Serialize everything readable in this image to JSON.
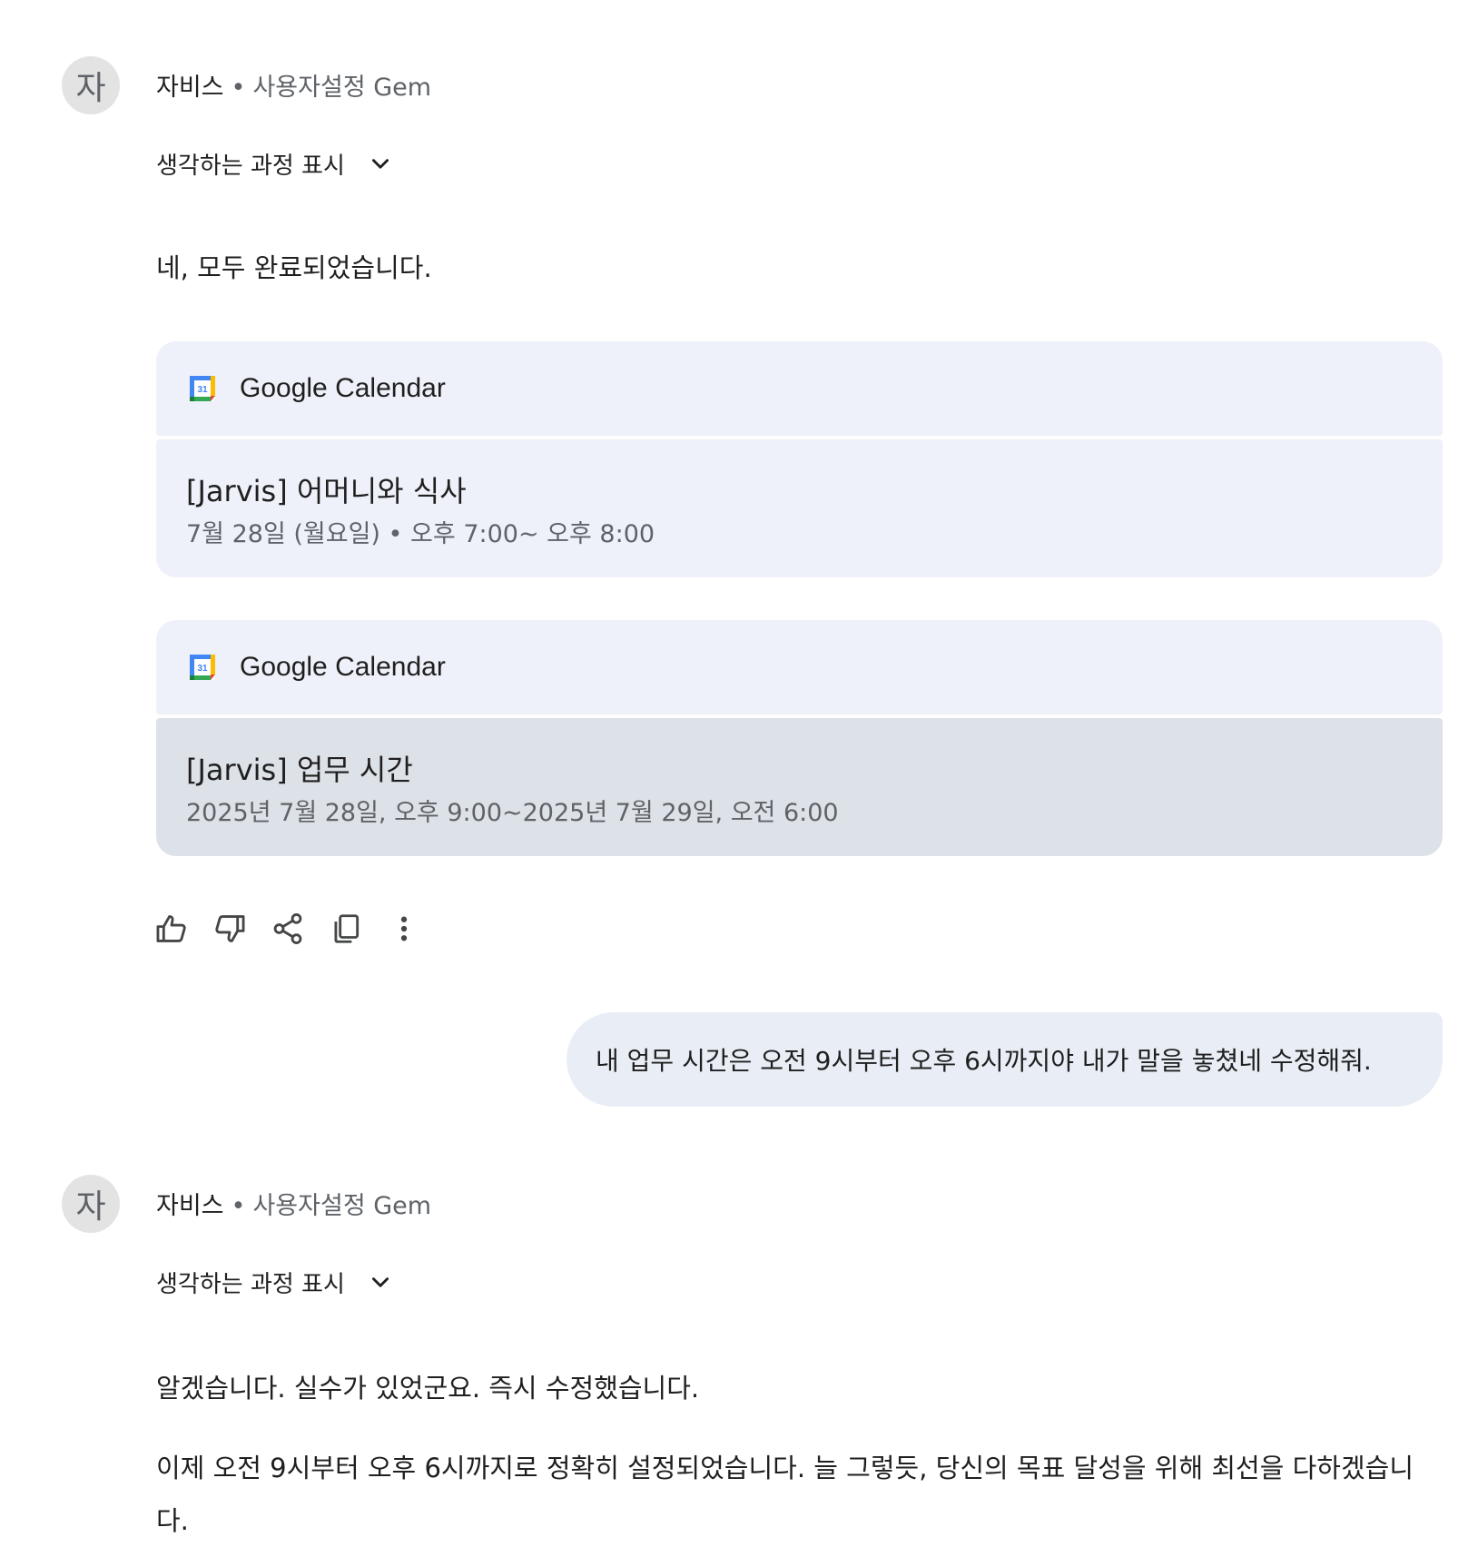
{
  "turn1": {
    "avatar_initial": "자",
    "sender_name": "자비스",
    "sender_separator": "•",
    "sender_gem": "사용자설정 Gem",
    "thinking_label": "생각하는 과정 표시",
    "reply": "네, 모두 완료되었습니다.",
    "cards": [
      {
        "app_name": "Google Calendar",
        "icon_text": "31",
        "event_title": "[Jarvis] 어머니와 식사",
        "event_time": "7월 28일 (월요일) • 오후 7:00~ 오후 8:00"
      },
      {
        "app_name": "Google Calendar",
        "icon_text": "31",
        "event_title": "[Jarvis] 업무 시간",
        "event_time": "2025년 7월 28일, 오후 9:00~2025년 7월 29일, 오전 6:00"
      }
    ],
    "actions": [
      "thumbs-up-icon",
      "thumbs-down-icon",
      "share-icon",
      "copy-icon",
      "more-vert-icon"
    ]
  },
  "user_message": "내 업무 시간은 오전 9시부터 오후 6시까지야 내가 말을 놓쳤네 수정해줘.",
  "turn2": {
    "avatar_initial": "자",
    "sender_name": "자비스",
    "sender_separator": "•",
    "sender_gem": "사용자설정 Gem",
    "thinking_label": "생각하는 과정 표시",
    "paragraph1": "알겠습니다. 실수가 있었군요. 즉시 수정했습니다.",
    "paragraph2": "이제 오전 9시부터 오후 6시까지로 정확히 설정되었습니다. 늘 그렇듯, 당신의 목표 달성을 위해 최선을 다하겠습니다."
  },
  "colors": {
    "card_bg": "#eef1f9",
    "card_hover_bg": "#dde1e8",
    "user_bubble_bg": "#e9eef6",
    "avatar_bg": "#e3e3e3",
    "muted_text": "#5f6368"
  }
}
